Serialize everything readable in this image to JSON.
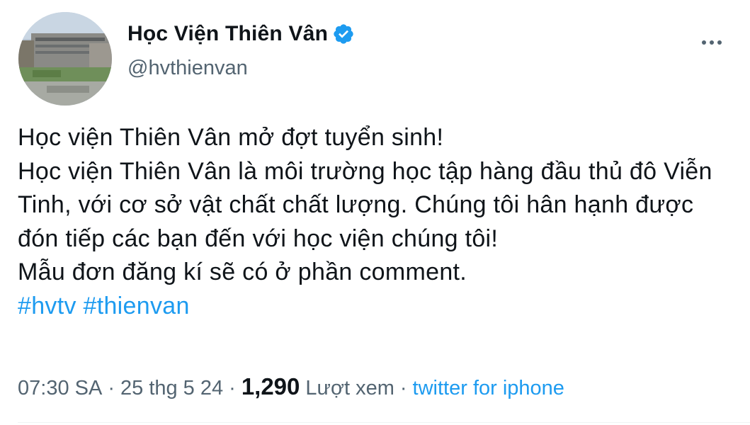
{
  "author": {
    "display_name": "Học Viện Thiên Vân",
    "handle": "@hvthienvan",
    "verified": true
  },
  "tweet": {
    "lines": [
      "Học viện Thiên Vân mở đợt tuyển sinh!",
      "Học viện Thiên Vân là môi trường học tập hàng đầu thủ đô Viễn Tinh, với cơ sở vật chất chất lượng. Chúng tôi hân hạnh được đón tiếp các bạn đến với học viện chúng tôi!",
      "Mẫu đơn đăng kí sẽ có ở phần comment."
    ],
    "hashtags": [
      "#hvtv",
      "#thienvan"
    ]
  },
  "meta": {
    "time": "07:30 SA",
    "date": "25 thg 5 24",
    "views_count": "1,290",
    "views_label": "Lượt xem",
    "source": "twitter for iphone",
    "separator": "·"
  },
  "colors": {
    "accent": "#1d9bf0",
    "text_primary": "#0f1419",
    "text_secondary": "#536471"
  },
  "icons": {
    "verified": "verified-badge-icon",
    "more": "more-options-icon"
  }
}
